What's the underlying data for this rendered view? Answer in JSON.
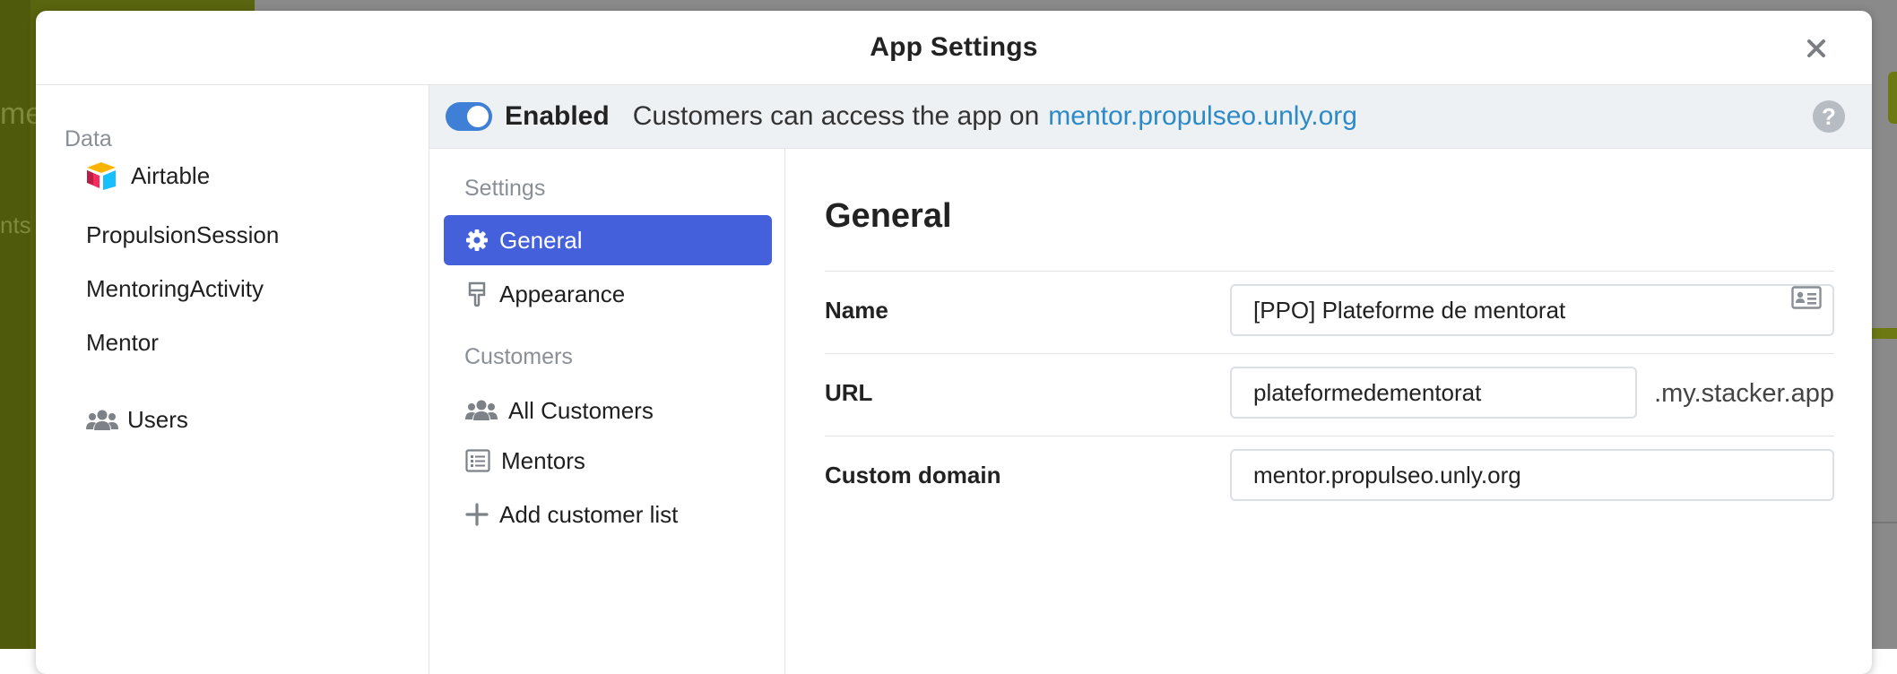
{
  "background": {
    "left_fragments": [
      "me",
      "nts"
    ]
  },
  "modal": {
    "title": "App Settings",
    "close_icon": "close-icon"
  },
  "data_sidebar": {
    "heading": "Data",
    "source": {
      "label": "Airtable",
      "icon": "airtable-logo"
    },
    "tables": [
      "PropulsionSession",
      "MentoringActivity",
      "Mentor"
    ],
    "users": {
      "label": "Users",
      "icon": "users-icon"
    }
  },
  "enabled_bar": {
    "toggle_on": true,
    "label": "Enabled",
    "text": "Customers can access the app on",
    "link": "mentor.propulseo.unly.org",
    "help": "?"
  },
  "settings_nav": {
    "settings_heading": "Settings",
    "general": "General",
    "appearance": "Appearance",
    "customers_heading": "Customers",
    "all_customers": "All Customers",
    "mentors": "Mentors",
    "add_list": "Add customer list"
  },
  "main": {
    "title": "General",
    "name_label": "Name",
    "name_value": "[PPO] Plateforme de mentorat",
    "url_label": "URL",
    "url_value": "plateformedementorat",
    "url_suffix": ".my.stacker.app",
    "domain_label": "Custom domain",
    "domain_value": "mentor.propulseo.unly.org"
  },
  "colors": {
    "accent": "#4560db",
    "toggle": "#3f7fd6",
    "link": "#2c8ac6",
    "backdrop_green": "#5a650f"
  }
}
